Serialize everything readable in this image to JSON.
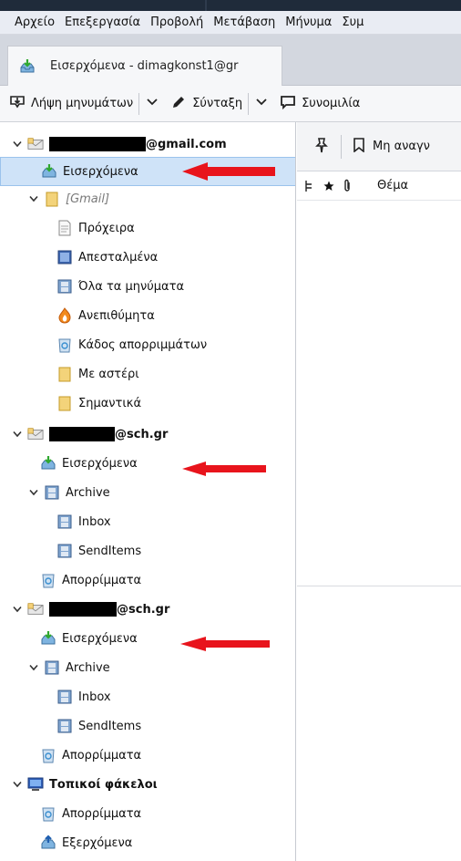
{
  "menubar": {
    "items": [
      {
        "label": "Αρχείο"
      },
      {
        "label": "Επεξεργασία"
      },
      {
        "label": "Προβολή"
      },
      {
        "label": "Μετάβαση"
      },
      {
        "label": "Μήνυμα"
      },
      {
        "label": "Συμ"
      }
    ]
  },
  "tab": {
    "title": "Εισερχόμενα - dimagkonst1@gr"
  },
  "toolbar": {
    "get_messages": "Λήψη μηνυμάτων",
    "compose": "Σύνταξη",
    "chat": "Συνομιλία"
  },
  "threadpane": {
    "unread_filter": "Μη αναγν",
    "subject_column": "Θέμα"
  },
  "folders": [
    {
      "label": "@gmail.com",
      "type": "account",
      "redacted": true
    },
    {
      "label": "Εισερχόμενα",
      "type": "inbox",
      "selected": true
    },
    {
      "label": "[Gmail]",
      "type": "group"
    },
    {
      "label": "Πρόχειρα",
      "type": "drafts"
    },
    {
      "label": "Απεσταλμένα",
      "type": "sent"
    },
    {
      "label": "Όλα τα μηνύματα",
      "type": "archive"
    },
    {
      "label": "Ανεπιθύμητα",
      "type": "junk"
    },
    {
      "label": "Κάδος απορριμμάτων",
      "type": "trash"
    },
    {
      "label": "Με αστέρι",
      "type": "folder"
    },
    {
      "label": "Σημαντικά",
      "type": "folder"
    },
    {
      "label": "@sch.gr",
      "type": "account",
      "redacted": true
    },
    {
      "label": "Εισερχόμενα",
      "type": "inbox"
    },
    {
      "label": "Archive",
      "type": "archive"
    },
    {
      "label": "Inbox",
      "type": "archive"
    },
    {
      "label": "SendItems",
      "type": "archive"
    },
    {
      "label": "Απορρίμματα",
      "type": "trash"
    },
    {
      "label": "@sch.gr",
      "type": "account",
      "redacted": true
    },
    {
      "label": "Εισερχόμενα",
      "type": "inbox"
    },
    {
      "label": "Archive",
      "type": "archive"
    },
    {
      "label": "Inbox",
      "type": "archive"
    },
    {
      "label": "SendItems",
      "type": "archive"
    },
    {
      "label": "Απορρίμματα",
      "type": "trash"
    },
    {
      "label": "Τοπικοί φάκελοι",
      "type": "local"
    },
    {
      "label": "Απορρίμματα",
      "type": "trash"
    },
    {
      "label": "Εξερχόμενα",
      "type": "outbox"
    }
  ],
  "colors": {
    "selected_bg": "#cfe3f8",
    "arrow_red": "#e8141c",
    "menubar_bg": "#e9ecf3"
  }
}
